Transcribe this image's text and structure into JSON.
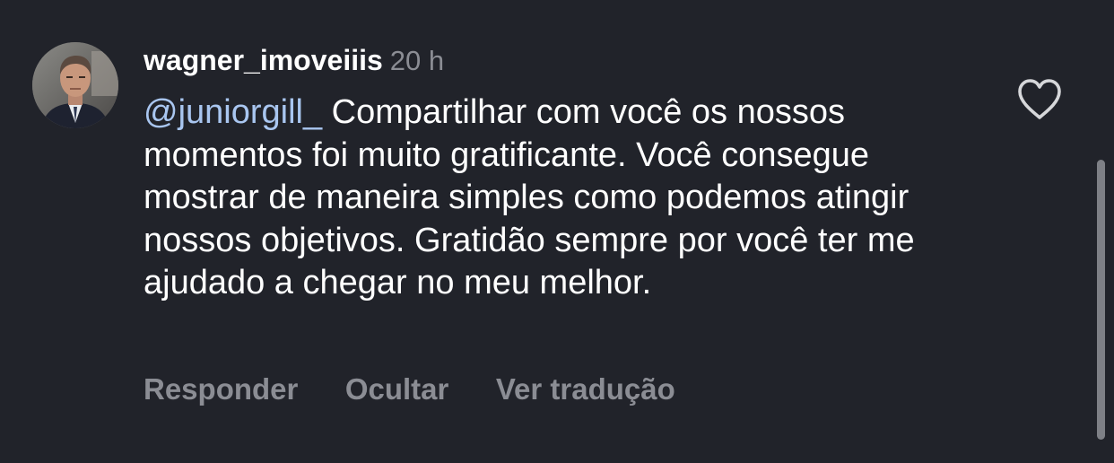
{
  "comment": {
    "username": "wagner_imoveiiis",
    "time": "20 h",
    "mention": "@juniorgill_",
    "text": " Compartilhar com você os nossos momentos foi muito gratificante. Você consegue mostrar de maneira simples como podemos atingir nossos objetivos. Gratidão sempre por você ter me ajudado a chegar no meu melhor.",
    "actions": {
      "reply": "Responder",
      "hide": "Ocultar",
      "translate": "Ver tradução"
    },
    "like_icon": "heart-outline-icon"
  },
  "colors": {
    "background": "#21232a",
    "text": "#ffffff",
    "mention": "#a9c6f0",
    "muted": "#8b8d94"
  }
}
